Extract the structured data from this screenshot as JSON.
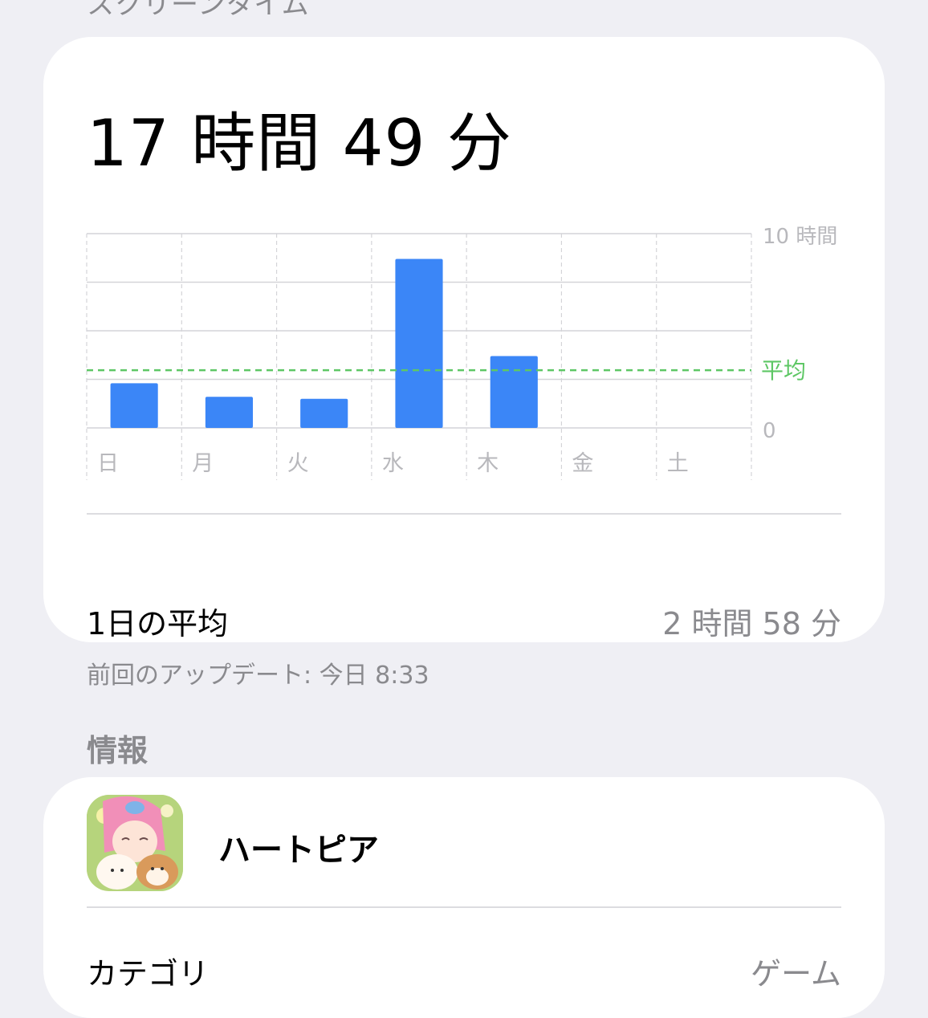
{
  "header": {
    "title": "スクリーンタイム"
  },
  "summary": {
    "total": "17 時間 49 分",
    "daily_average_label": "1日の平均",
    "daily_average_value": "2 時間 58 分"
  },
  "chart_data": {
    "type": "bar",
    "categories": [
      "日",
      "月",
      "火",
      "水",
      "木",
      "金",
      "土"
    ],
    "values": [
      2.3,
      1.6,
      1.5,
      8.7,
      3.7,
      0,
      0
    ],
    "average": 2.97,
    "ylim": [
      0,
      10
    ],
    "ytick_labels": [
      "10 時間",
      "0"
    ],
    "average_label": "平均",
    "grid": true,
    "colors": {
      "bar": "#3b86f7",
      "average": "#5ec765",
      "grid": "#d4d4d8",
      "label": "#b8b8bc"
    }
  },
  "footnote": "前回のアップデート: 今日 8:33",
  "info": {
    "section_title": "情報",
    "app_name": "ハートピア",
    "app_icon": "heartopia-app-icon",
    "row_label_partial": "カテゴリ",
    "row_value_partial": "ゲーム"
  }
}
